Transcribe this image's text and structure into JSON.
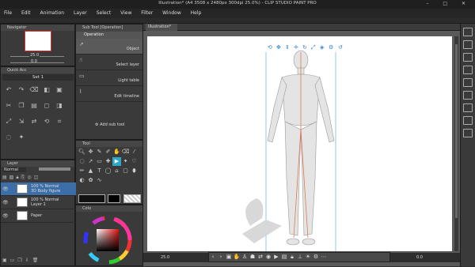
{
  "window": {
    "title": "Illustration* (A4 3508 x 2480px 300dpi 25.0%) - CLIP STUDIO PAINT PRO",
    "controls": [
      "–",
      "□",
      "✕"
    ]
  },
  "menu": [
    "File",
    "Edit",
    "Animation",
    "Layer",
    "Select",
    "View",
    "Filter",
    "Window",
    "Help"
  ],
  "navigator": {
    "tab": "Navigator",
    "zoom": "25.0",
    "rotation": "0.0"
  },
  "quick_access": {
    "tab": "Quick Acc",
    "set_label": "Set 1"
  },
  "sub_tool": {
    "tab": "Sub Tool [Operation]",
    "category": "Operation",
    "items": [
      {
        "label": "Object",
        "icon": "object-icon",
        "selected": true
      },
      {
        "label": "Select layer",
        "icon": "select-layer-icon",
        "selected": false
      },
      {
        "label": "Light table",
        "icon": "light-table-icon",
        "selected": false
      },
      {
        "label": "Edit timeline",
        "icon": "edit-timeline-icon",
        "selected": false
      }
    ],
    "add_sub_tool": "Add sub tool"
  },
  "tool": {
    "tab": "Tool"
  },
  "color": {
    "tab": "Colo"
  },
  "layers": {
    "tab": "Layer",
    "blend_mode": "Normal",
    "rows": [
      {
        "name": "3D Body figure",
        "info": "100 % Normal",
        "selected": true
      },
      {
        "name": "Layer 1",
        "info": "100 % Normal",
        "selected": false
      },
      {
        "name": "Paper",
        "info": "",
        "selected": false
      }
    ]
  },
  "canvas": {
    "doc_tab": "Illustration*",
    "zoom": "25.0",
    "page_value": "0.0"
  },
  "colors": {
    "selected_layer": "#3c6fa8",
    "accent": "#2aa7c9",
    "guide": "#3fa9e0",
    "bone": "#e06a3a"
  }
}
